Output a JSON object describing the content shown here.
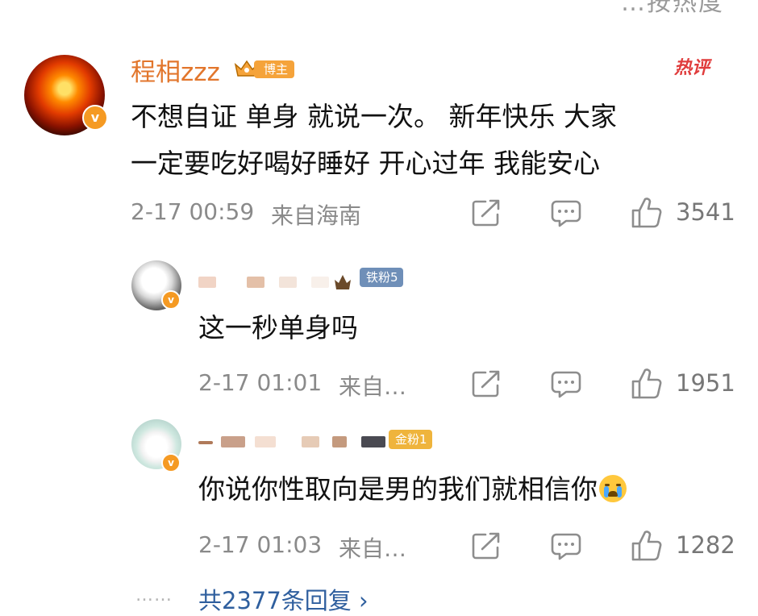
{
  "top_cut_text": "…按热度",
  "main_comment": {
    "username": "程相zzz",
    "badge": "博主",
    "hot_tag": "热评",
    "text_line1": "不想自证 单身 就说一次。 新年快乐 大家",
    "text_line2": "一定要吃好喝好睡好 开心过年 我能安心",
    "time": "2-17 00:59",
    "location": "来自海南",
    "likes": "3541",
    "avatar_badge": "v"
  },
  "replies": [
    {
      "fan_badge": "铁粉5",
      "text": "这一秒单身吗",
      "time": "2-17 01:01",
      "location": "来自…",
      "likes": "1951",
      "avatar_badge": "v"
    },
    {
      "fan_badge": "金粉1",
      "text": "你说你性取向是男的我们就相信你",
      "time": "2-17 01:03",
      "location": "来自…",
      "likes": "1282",
      "avatar_badge": "v"
    }
  ],
  "more_replies": "共2377条回复 ›",
  "more_dots": "……",
  "icons": [
    "share-icon",
    "comment-icon",
    "like-icon"
  ],
  "colors": {
    "username": "#e2762c",
    "link": "#2f5f9e",
    "hot": "#e03c3c",
    "meta": "#8a8a8a"
  }
}
